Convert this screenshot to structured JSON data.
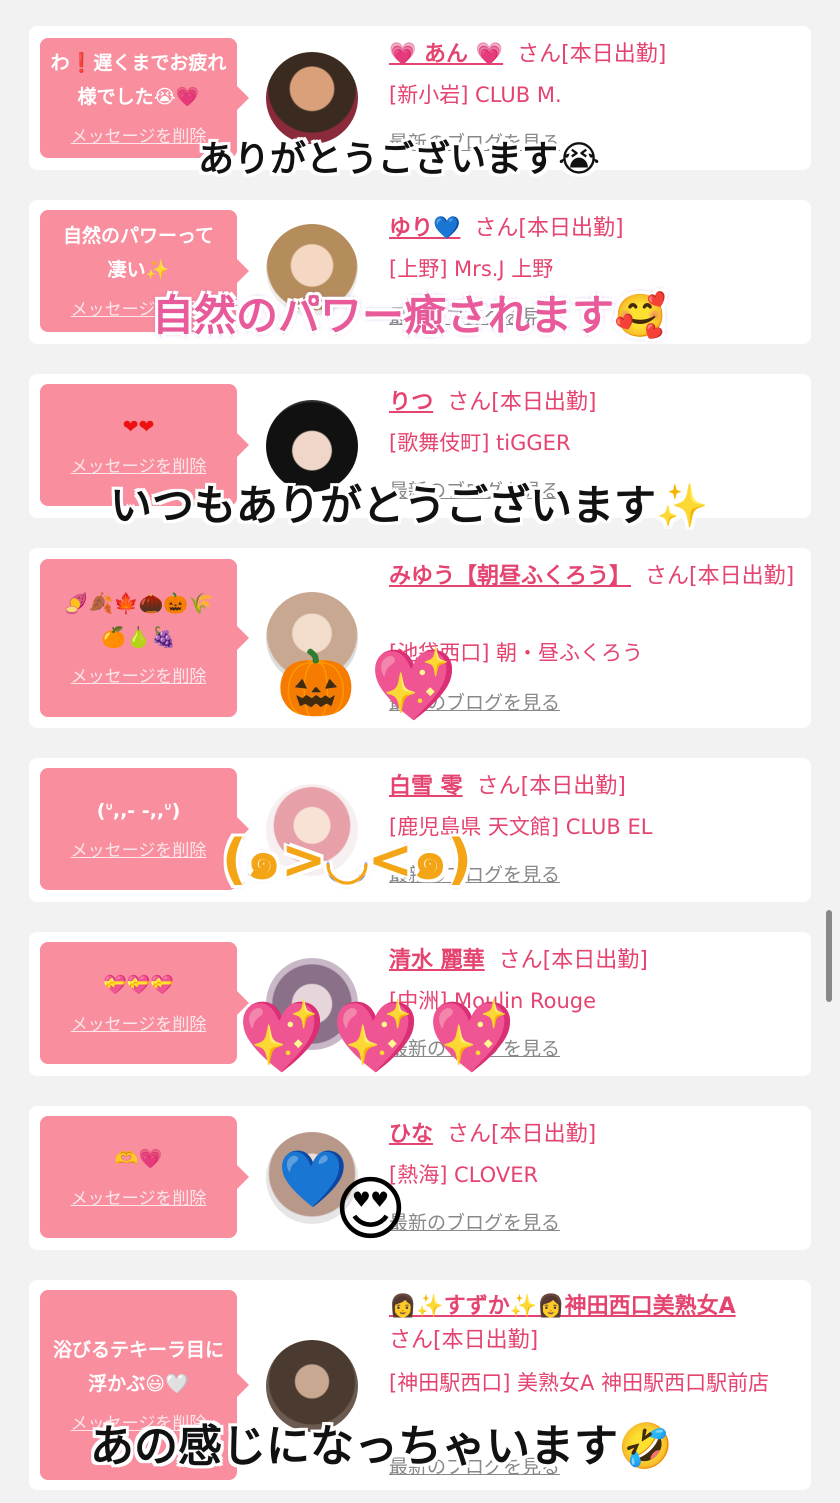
{
  "cards": [
    {
      "message": "わ❗遅くまでお疲れ様でした😭💗",
      "delete_label": "メッセージを削除",
      "name": "💗 あん 💗",
      "suffix": "さん[本日出勤]",
      "shop": "[新小岩] CLUB M.",
      "blog_label": "最新のブログを見る"
    },
    {
      "message": "自然のパワーって凄い✨",
      "delete_label": "メッセージを削除",
      "name": "ゆり💙",
      "suffix": "さん[本日出勤]",
      "shop": "[上野] Mrs.J 上野",
      "blog_label": "最新のブログを見る"
    },
    {
      "message": "❤❤",
      "delete_label": "メッセージを削除",
      "name": "りつ",
      "suffix": "さん[本日出勤]",
      "shop": "[歌舞伎町] tiGGER",
      "blog_label": "最新のブログを見る"
    },
    {
      "message": "🍠🍂🍁🌰🎃🌾🍊🍐🍇",
      "delete_label": "メッセージを削除",
      "name": "みゆう【朝昼ふくろう】",
      "suffix": "さん[本日出勤]",
      "shop": "[池袋西口] 朝・昼ふくろう",
      "blog_label": "最新のブログを見る"
    },
    {
      "message": "(ᐡ,,- -,,ᐡ)",
      "delete_label": "メッセージを削除",
      "name": "白雪 零",
      "suffix": "さん[本日出勤]",
      "shop": "[鹿児島県 天文館] CLUB EL",
      "blog_label": "最新のブログを見る"
    },
    {
      "message": "💝💝💝",
      "delete_label": "メッセージを削除",
      "name": "清水 麗華",
      "suffix": "さん[本日出勤]",
      "shop": "[中洲] Moulin Rouge",
      "blog_label": "最新のブログを見る"
    },
    {
      "message": "🫶💗",
      "delete_label": "メッセージを削除",
      "name": "ひな",
      "suffix": "さん[本日出勤]",
      "shop": "[熱海] CLOVER",
      "blog_label": "最新のブログを見る"
    },
    {
      "message": "浴びるテキーラ目に浮かぶ😃🤍",
      "delete_label": "メッセージを削除",
      "name": "👩✨すずか✨👩神田西口美熟女A",
      "suffix": "さん[本日出勤]",
      "shop": "[神田駅西口] 美熟女A 神田駅西口駅前店",
      "blog_label": "最新のブログを見る"
    }
  ],
  "overlays": {
    "t1": "ありがとうございます😭",
    "t2": "自然のパワー癒されます🥰",
    "t3": "いつもありがとうございます✨",
    "t4": "(๑>◡<๑)",
    "t5": "あの感じになっちゃいます🤣"
  },
  "stickers": {
    "pumpkin": "🎃",
    "sparkle_heart": "💖",
    "blue_heart": "💙",
    "heart_eyes": "😍"
  },
  "colors": {
    "accent": "#e4446f",
    "bubble": "#f88e9e",
    "background": "#f2f2f2"
  }
}
